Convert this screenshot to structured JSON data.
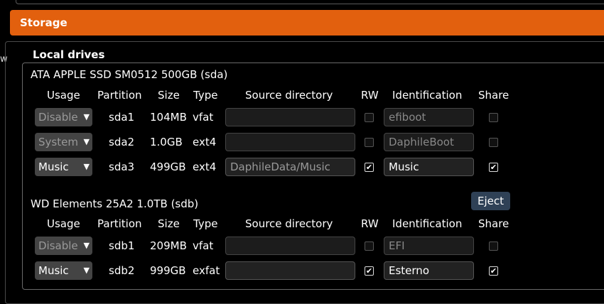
{
  "section": {
    "title": "Storage",
    "legend": "Local drives",
    "left_glyph": "w"
  },
  "columns": {
    "usage": "Usage",
    "partition": "Partition",
    "size": "Size",
    "type": "Type",
    "source": "Source directory",
    "rw": "RW",
    "identification": "Identification",
    "share": "Share"
  },
  "drives": [
    {
      "title": "ATA APPLE SSD SM0512 500GB (sda)",
      "rows": [
        {
          "usage": "Disable",
          "usage_enabled": false,
          "partition": "sda1",
          "size": "104MB",
          "type": "vfat",
          "source": "",
          "rw": false,
          "identification": "efiboot",
          "share": false
        },
        {
          "usage": "System",
          "usage_enabled": false,
          "partition": "sda2",
          "size": "1.0GB",
          "type": "ext4",
          "source": "",
          "rw": false,
          "identification": "DaphileBoot",
          "share": false
        },
        {
          "usage": "Music",
          "usage_enabled": true,
          "partition": "sda3",
          "size": "499GB",
          "type": "ext4",
          "source": "DaphileData/Music",
          "rw": true,
          "identification": "Music",
          "share": true
        }
      ]
    },
    {
      "title": "WD Elements 25A2 1.0TB (sdb)",
      "eject_label": "Eject",
      "rows": [
        {
          "usage": "Disable",
          "usage_enabled": false,
          "partition": "sdb1",
          "size": "209MB",
          "type": "vfat",
          "source": "",
          "rw": false,
          "identification": "EFI",
          "share": false
        },
        {
          "usage": "Music",
          "usage_enabled": true,
          "partition": "sdb2",
          "size": "999GB",
          "type": "exfat",
          "source": "",
          "rw": true,
          "identification": "Esterno",
          "share": true
        }
      ]
    }
  ],
  "colors": {
    "accent": "#e2600e",
    "eject_button": "#2f4156",
    "select_bg": "#444444"
  },
  "icons": {
    "dropdown": "triangle-down-icon",
    "checked": "check-icon"
  }
}
